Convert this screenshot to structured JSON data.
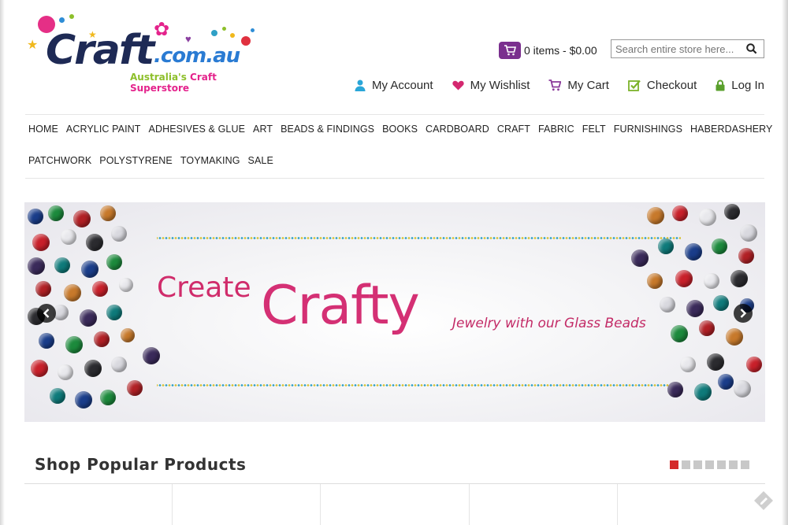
{
  "logo": {
    "word": "Craft",
    "domain": ".com.au",
    "tag_part1": "Australia's ",
    "tag_part2": "Craft Superstore"
  },
  "cart_summary": {
    "text": "0 items - $0.00",
    "icon": "cart-icon"
  },
  "search": {
    "placeholder": "Search entire store here...",
    "icon": "search-icon"
  },
  "account_links": [
    {
      "label": "My Account",
      "icon": "user-icon",
      "color": "#2aa6d8"
    },
    {
      "label": "My Wishlist",
      "icon": "heart-icon",
      "color": "#d4286f"
    },
    {
      "label": "My Cart",
      "icon": "cart-icon",
      "color": "#8a3a9a"
    },
    {
      "label": "Checkout",
      "icon": "checkbox-icon",
      "color": "#7cb32a"
    },
    {
      "label": "Log In",
      "icon": "lock-icon",
      "color": "#5aa02c"
    }
  ],
  "nav": {
    "row1": [
      "HOME",
      "ACRYLIC PAINT",
      "ADHESIVES & GLUE",
      "ART",
      "BEADS & FINDINGS",
      "BOOKS",
      "CARDBOARD",
      "CRAFT",
      "FABRIC",
      "FELT",
      "FURNISHINGS",
      "HABERDASHERY"
    ],
    "row2": [
      "PATCHWORK",
      "POLYSTYRENE",
      "TOYMAKING",
      "SALE"
    ]
  },
  "banner": {
    "create": "Create",
    "crafty": "Crafty",
    "subtitle": "Jewelry with our Glass Beads"
  },
  "section": {
    "title": "Shop Popular Products"
  },
  "pager": {
    "count": 7,
    "active_index": 0
  },
  "colors": {
    "brand_navy": "#1e2a55",
    "brand_pink": "#d43074",
    "pager_active": "#d42a2a"
  }
}
